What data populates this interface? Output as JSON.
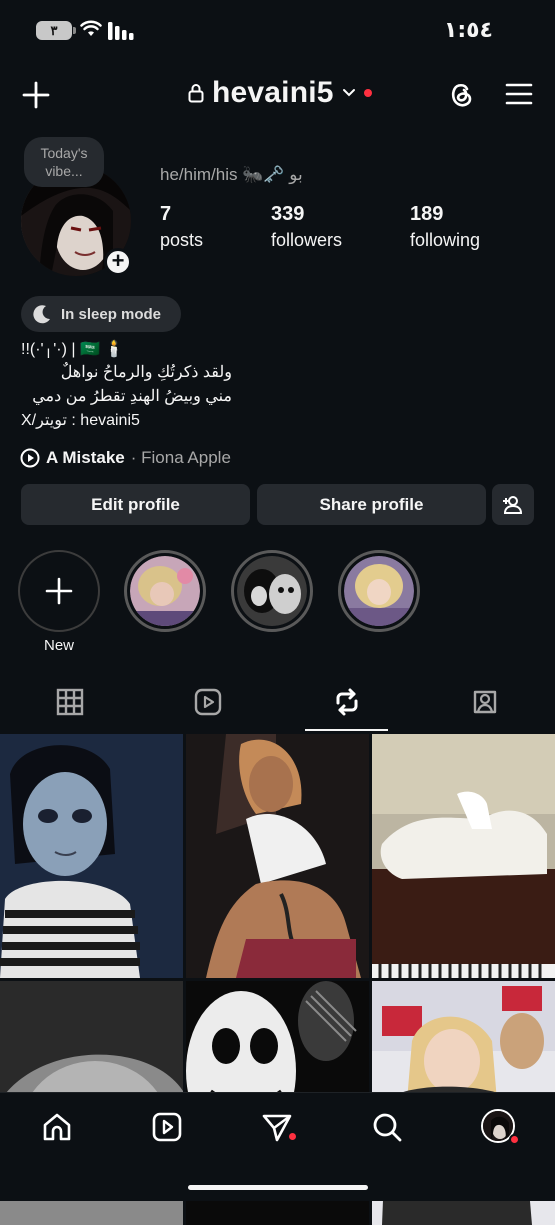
{
  "status_bar": {
    "time": "١:٥٤",
    "battery": "٣"
  },
  "header": {
    "username": "hevaini5"
  },
  "profile": {
    "note": "Today's vibe...",
    "pronouns": "he/him/his 🐜🗝️ بو",
    "stats": [
      {
        "number": "7",
        "label": "posts"
      },
      {
        "number": "339",
        "label": "followers"
      },
      {
        "number": "189",
        "label": "following"
      }
    ],
    "sleep_mode": "In sleep mode",
    "bio_lines": [
      "!!(·'╷'·) | 🇸🇦 🕯️",
      "ولقد ذكرتُكِ والرماحُ نواهلٌ",
      "مني وبيضُ الهندِ تقطرُ من دمي",
      "X/تويتر : hevaini5"
    ],
    "song_title": "A Mistake",
    "song_artist": "· Fiona Apple"
  },
  "buttons": {
    "edit": "Edit profile",
    "share": "Share profile"
  },
  "highlights": {
    "new_label": "New"
  },
  "colors": {
    "background": "#0c1014",
    "button": "#262a2f",
    "accent_red": "#ff3040",
    "text_secondary": "#a8a8a8"
  }
}
